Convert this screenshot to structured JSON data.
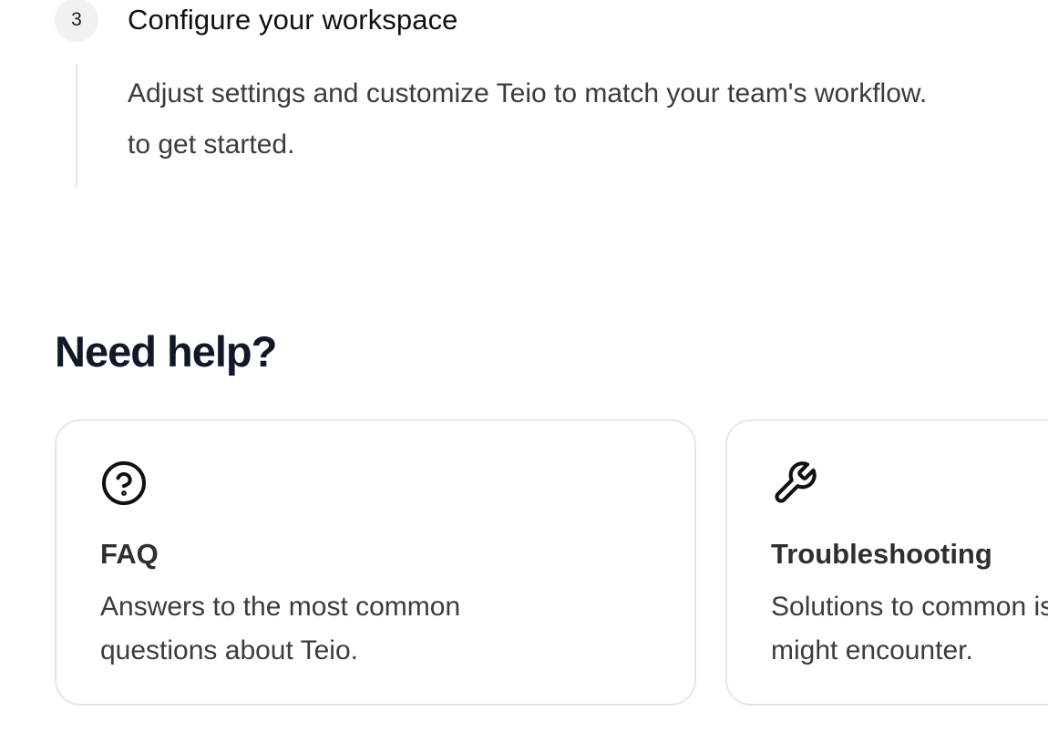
{
  "step": {
    "number": "3",
    "title": "Configure your workspace",
    "description": "Adjust settings and customize Teio to match your team's workflow.\nto get started."
  },
  "help": {
    "heading": "Need help?",
    "cards": [
      {
        "title": "FAQ",
        "description": "Answers to the most common questions about Teio.",
        "icon": "question-circle-icon"
      },
      {
        "title": "Troubleshooting",
        "description": "Solutions to common issues you might encounter.",
        "icon": "wrench-icon"
      }
    ]
  }
}
